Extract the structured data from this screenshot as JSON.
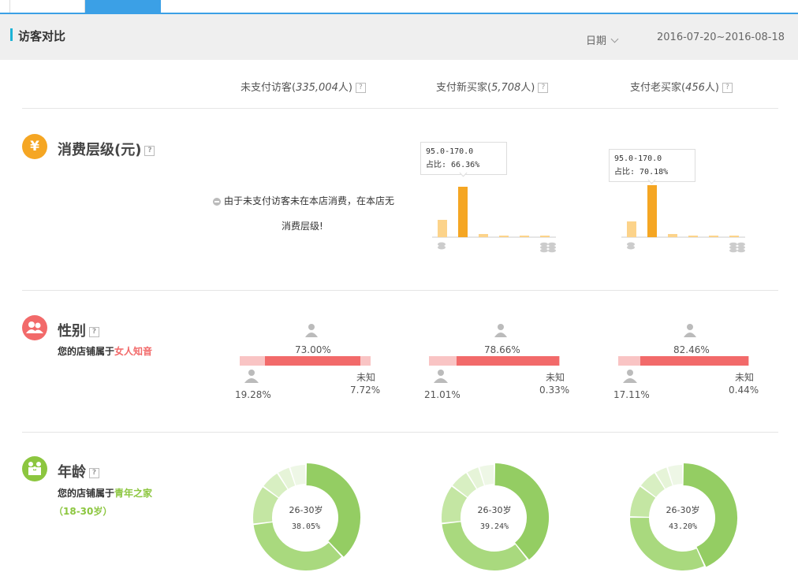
{
  "header": {
    "title": "访客对比",
    "date_label": "日期",
    "date_range": "2016-07-20~2016-08-18"
  },
  "columns": [
    {
      "label": "未支付访客(",
      "count": "335,004",
      "suffix": "人)"
    },
    {
      "label": "支付新买家(",
      "count": "5,708",
      "suffix": "人)"
    },
    {
      "label": "支付老买家(",
      "count": "456",
      "suffix": "人)"
    }
  ],
  "help_glyph": "?",
  "consumption": {
    "icon": "yen-icon",
    "icon_glyph": "¥",
    "title": "消费层级(元)",
    "note_line1": "由于未支付访客未在本店消费，在本店无",
    "note_line2": "消费层级!",
    "charts": [
      {
        "range": "95.0-170.0",
        "ratio": "占比: 66.36%",
        "values": [
          0.11,
          0.32,
          0.02,
          0.005,
          0.005,
          0.005
        ]
      },
      {
        "range": "95.0-170.0",
        "ratio": "占比: 70.18%",
        "values": [
          0.1,
          0.33,
          0.02,
          0.005,
          0.005,
          0.005
        ]
      }
    ]
  },
  "gender": {
    "icon": "people-icon",
    "title": "性别",
    "subtitle_prefix": "您的店铺属于",
    "subtitle_highlight": "女人知音",
    "unknown_label": "未知",
    "columns": [
      {
        "female": "73.00%",
        "male": "19.28%",
        "unknown": "7.72%",
        "female_value": 73.0,
        "male_value": 19.28,
        "unknown_value": 7.72
      },
      {
        "female": "78.66%",
        "male": "21.01%",
        "unknown": "0.33%",
        "female_value": 78.66,
        "male_value": 21.01,
        "unknown_value": 0.33
      },
      {
        "female": "82.46%",
        "male": "17.11%",
        "unknown": "0.44%",
        "female_value": 82.46,
        "male_value": 17.11,
        "unknown_value": 0.44
      }
    ]
  },
  "age": {
    "icon": "family-icon",
    "title": "年龄",
    "subtitle_prefix": "您的店铺属于",
    "subtitle_highlight": "青年之家",
    "subtitle_range": "（18-30岁）",
    "donuts": [
      {
        "label": "26-30岁",
        "pct": "38.05%",
        "segments": [
          38.05,
          35,
          12,
          6,
          4,
          5
        ]
      },
      {
        "label": "26-30岁",
        "pct": "39.24%",
        "segments": [
          39.24,
          34,
          12,
          6,
          4,
          4.76
        ]
      },
      {
        "label": "26-30岁",
        "pct": "43.20%",
        "segments": [
          43.2,
          32,
          10,
          6,
          4,
          4.8
        ]
      }
    ]
  },
  "colors": {
    "accent": "#3ba0e6",
    "yen": "#f5a623",
    "gender": "#f26a6a",
    "age": "#8cc63f",
    "bar_highlight": "#f5a623",
    "bar_light": "#fcd38a"
  }
}
